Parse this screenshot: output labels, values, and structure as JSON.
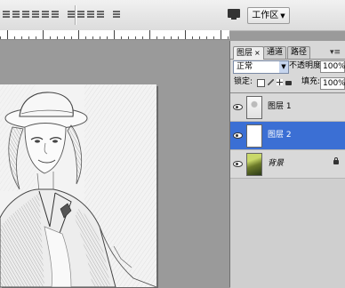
{
  "options_bar": {
    "workspace_label": "工作区",
    "workspace_caret": "▼"
  },
  "layers_panel": {
    "tabs": [
      {
        "label": "图层",
        "close": "×"
      },
      {
        "label": "通道"
      },
      {
        "label": "路径"
      }
    ],
    "blend_mode": "正常",
    "opacity_label": "不透明度:",
    "opacity_value": "100%",
    "lock_label": "锁定:",
    "fill_label": "填充:",
    "fill_value": "100%",
    "layers": [
      {
        "name": "图层 1",
        "selected": false
      },
      {
        "name": "图层 2",
        "selected": true
      },
      {
        "name": "背景",
        "selected": false,
        "locked": true
      }
    ]
  },
  "colors": {
    "selection": "#3b6fd4",
    "workspace_bg": "#9a9a9a",
    "panel_bg": "#d8d8d8"
  }
}
